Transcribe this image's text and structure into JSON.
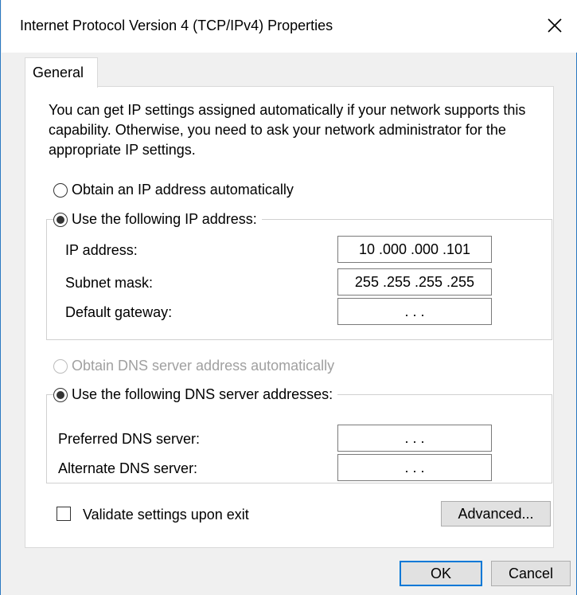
{
  "window": {
    "title": "Internet Protocol Version 4 (TCP/IPv4) Properties"
  },
  "tabs": [
    {
      "label": "General"
    }
  ],
  "intro_text": "You can get IP settings assigned automatically if your network supports this capability. Otherwise, you need to ask your network administrator for the appropriate IP settings.",
  "ip_section": {
    "auto_label": "Obtain an IP address automatically",
    "auto_selected": false,
    "manual_label": "Use the following IP address:",
    "manual_selected": true,
    "fields": [
      {
        "label": "IP address:",
        "value": "10 .000 .000 .101"
      },
      {
        "label": "Subnet mask:",
        "value": "255 .255 .255 .255"
      },
      {
        "label": "Default gateway:",
        "value": ". . ."
      }
    ]
  },
  "dns_section": {
    "auto_label": "Obtain DNS server address automatically",
    "auto_enabled": false,
    "manual_label": "Use the following DNS server addresses:",
    "manual_selected": true,
    "fields": [
      {
        "label": "Preferred DNS server:",
        "value": ". . ."
      },
      {
        "label": "Alternate DNS server:",
        "value": ". . ."
      }
    ]
  },
  "validate": {
    "label": "Validate settings upon exit",
    "checked": false
  },
  "buttons": {
    "advanced": "Advanced...",
    "ok": "OK",
    "cancel": "Cancel"
  },
  "colors": {
    "accent": "#0078d7",
    "window_border": "#2b79c2"
  },
  "icons": {
    "close": "close-icon"
  }
}
